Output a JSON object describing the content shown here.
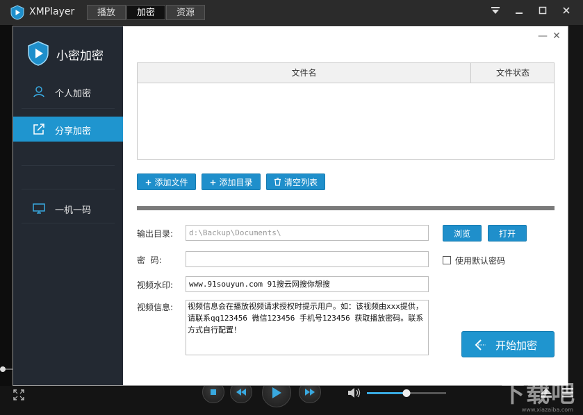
{
  "app": {
    "title": "XMPlayer"
  },
  "tabs": [
    {
      "label": "播放",
      "active": false
    },
    {
      "label": "加密",
      "active": true
    },
    {
      "label": "资源",
      "active": false
    }
  ],
  "window_controls": {
    "dropdown": "dropdown-icon",
    "minimize": "minimize-icon",
    "maximize": "maximize-icon",
    "close": "close-icon"
  },
  "dialog": {
    "title": "小密加密",
    "side_items": [
      {
        "label": "个人加密",
        "icon": "user-icon",
        "active": false
      },
      {
        "label": "分享加密",
        "icon": "share-icon",
        "active": true
      },
      {
        "label": "一机一码",
        "icon": "monitor-icon",
        "active": false
      }
    ],
    "controls": {
      "minimize": "—",
      "close": "✕"
    },
    "table": {
      "col_name": "文件名",
      "col_status": "文件状态",
      "rows": []
    },
    "buttons": {
      "add_file": "添加文件",
      "add_dir": "添加目录",
      "clear": "清空列表",
      "browse": "浏览",
      "open": "打开",
      "start": "开始加密"
    },
    "progress": 1.0,
    "fields": {
      "output_label": "输出目录:",
      "output_value": "d:\\Backup\\Documents\\",
      "password_label": "密  码:",
      "password_value": "",
      "watermark_label": "视频水印:",
      "watermark_value": "www.91souyun.com 91搜云网搜你想搜",
      "info_label": "视频信息:",
      "info_value": "视频信息会在播放视频请求授权时提示用户。如：该视频由xxx提供，请联系qq123456 微信123456 手机号123456 获取播放密码。联系方式自行配置！"
    },
    "checkbox": {
      "label": "使用默认密码",
      "checked": false
    }
  },
  "player": {
    "volume": 0.5
  },
  "site_watermark": {
    "main": "下载吧",
    "sub": "www.xiazaiba.com"
  },
  "colors": {
    "accent": "#1f95cf",
    "sidebar": "#232932",
    "titlebar": "#2b2b2b"
  }
}
